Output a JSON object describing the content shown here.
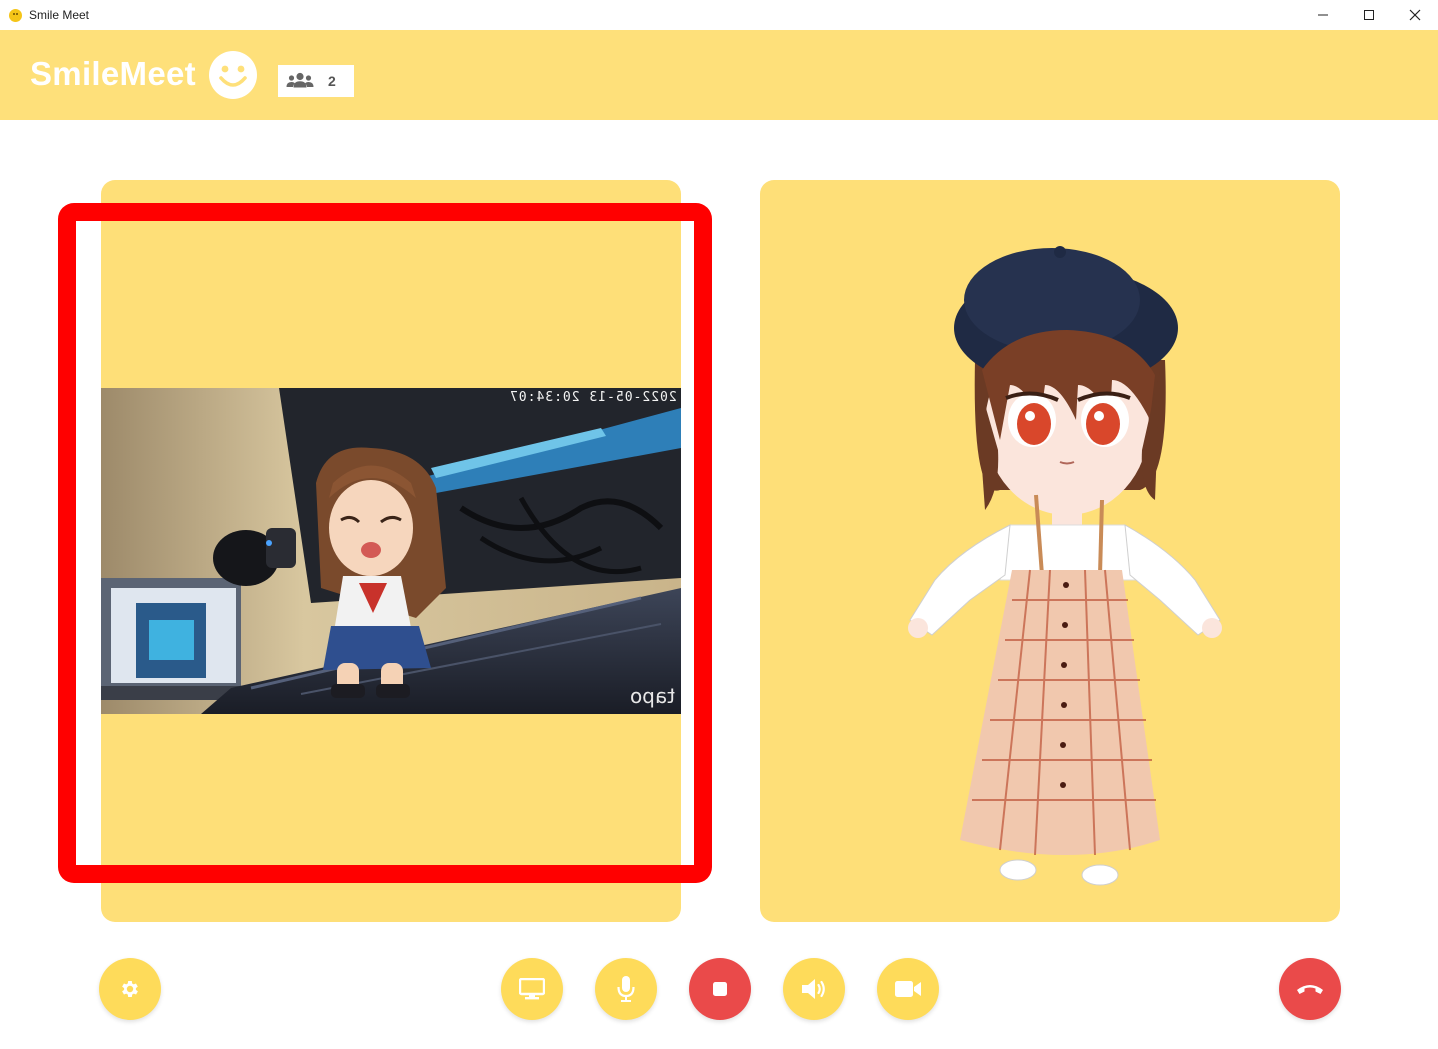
{
  "window": {
    "title": "Smile Meet"
  },
  "header": {
    "brand": "SmileMeet",
    "participant_count": "2"
  },
  "local_video": {
    "timestamp": "2022-05-13 20:34:07",
    "camera_watermark": "tapo"
  },
  "controls": {
    "settings": "settings",
    "screen_share": "screen-share",
    "microphone": "microphone",
    "stop": "stop",
    "speaker": "speaker",
    "camera": "camera",
    "hang_up": "hang-up"
  },
  "colors": {
    "accent": "#fee07a",
    "button": "#fedb5a",
    "danger": "#ea4a4a",
    "highlight": "#ff0000"
  }
}
